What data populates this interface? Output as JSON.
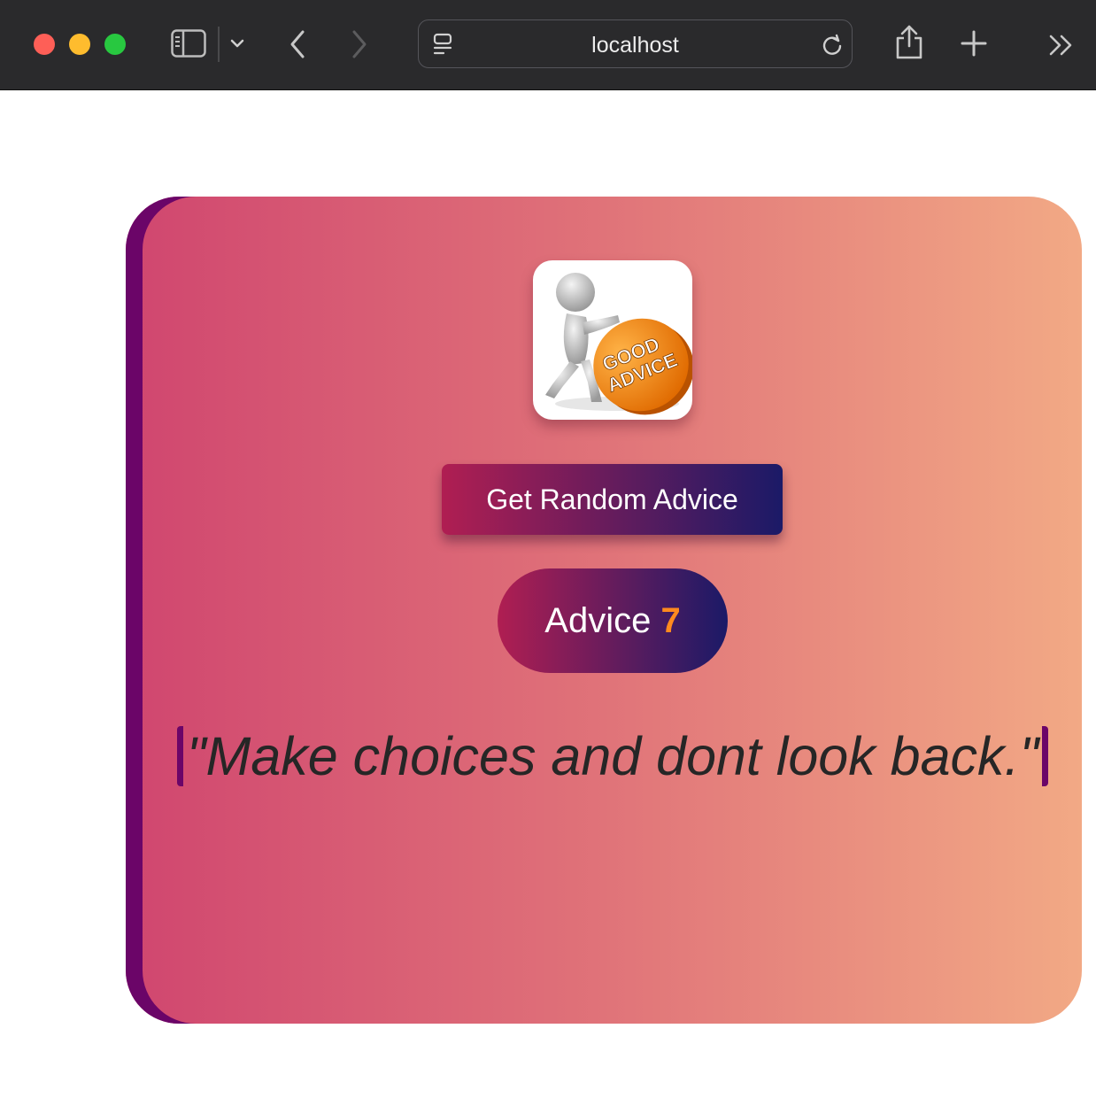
{
  "browser": {
    "url": "localhost",
    "colors": {
      "toolbar": "#2a2a2c",
      "close": "#fe5f57",
      "minimize": "#febc2e",
      "zoom": "#28c840"
    }
  },
  "card": {
    "colors": {
      "gradient_start": "#d0466f",
      "gradient_end": "#f2a985",
      "edge": "#6b0568",
      "button_start": "#b01e52",
      "button_end": "#1b1a67",
      "number": "#ff8a1e"
    },
    "logo": {
      "line1": "GOOD",
      "line2": "ADVICE",
      "icon": "good-advice-logo"
    },
    "button_label": "Get Random Advice",
    "advice_label": "Advice",
    "advice_number": "7",
    "quote": "\"Make choices and dont look back.\""
  }
}
